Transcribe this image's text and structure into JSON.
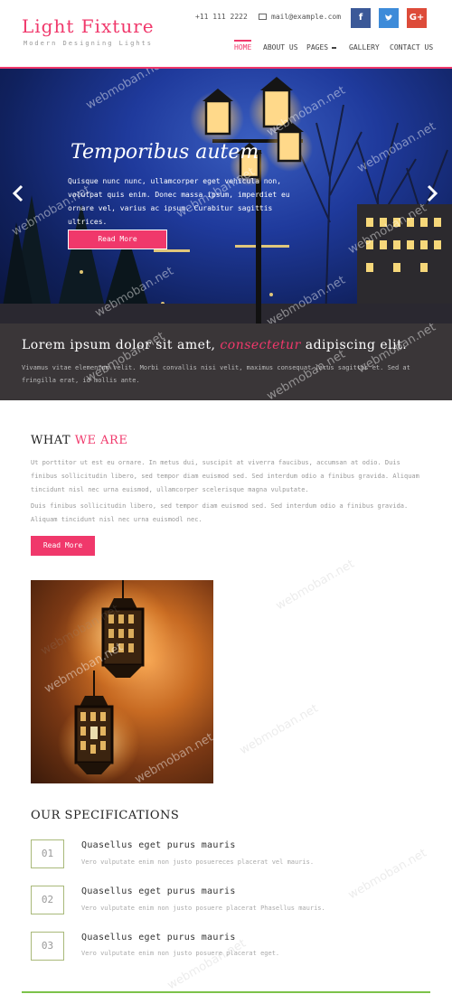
{
  "brand": {
    "title": "Light Fixture",
    "tagline": "Modern Designing Lights"
  },
  "contact": {
    "phone": "+11 111 2222",
    "email": "mail@example.com"
  },
  "social": {
    "facebook": "f",
    "twitter": "🐦",
    "google": "G+",
    "colors": {
      "facebook": "#3b5998",
      "twitter": "#3d8bd9",
      "google": "#dd4b39"
    }
  },
  "nav": {
    "home": "HOME",
    "about": "ABOUT US",
    "pages": "PAGES",
    "gallery": "GALLERY",
    "contact": "CONTACT US"
  },
  "hero": {
    "title": "Temporibus autem",
    "text": "Quisque nunc nunc, ullamcorper eget vehicula non, volutpat quis enim. Donec massa ipsum, imperdiet eu ornare vel, varius ac ipsum. Curabitur sagittis ultrices.",
    "button": "Read More",
    "prev_icon": "chevron-left-icon",
    "next_icon": "chevron-right-icon"
  },
  "banner": {
    "head_start": "Lorem ipsum dolor sit amet,",
    "head_accent": "consectetur",
    "head_end": "adipiscing elit.",
    "text": "Vivamus vitae elementum velit. Morbi convallis nisi velit, maximus consequat lacus sagittis et. Sed at fringilla erat, id mollis ante."
  },
  "about": {
    "title_start": "WHAT",
    "title_accent": "WE ARE",
    "para1": "Ut porttitor ut est eu ornare. In metus dui, suscipit at viverra faucibus, accumsan at odio. Duis finibus sollicitudin libero, sed tempor diam euismod sed. Sed interdum odio a finibus gravida. Aliquam tincidunt nisl nec urna euismod, ullamcorper scelerisque magna vulputate.",
    "para2": "Duis finibus sollicitudin libero, sed tempor diam euismod sed. Sed interdum odio a finibus gravida. Aliquam tincidunt nisl nec urna euismodl nec.",
    "button": "Read More"
  },
  "specs": {
    "title": "OUR SPECIFICATIONS",
    "items": [
      {
        "num": "01",
        "title": "Quasellus eget purus mauris",
        "text": "Vero vulputate enim non justo posuereces placerat vel mauris."
      },
      {
        "num": "02",
        "title": "Quasellus eget purus mauris",
        "text": "Vero vulputate enim non justo posuere placerat Phasellus mauris."
      },
      {
        "num": "03",
        "title": "Quasellus eget purus mauris",
        "text": "Vero vulputate enim non justo posuere placerat eget."
      }
    ]
  },
  "watermark": "webmoban.net",
  "colors": {
    "accent": "#f0386b",
    "banner_bg": "#3a3638",
    "spec_border": "#a9b97a",
    "footer_line": "#7cc24a"
  }
}
